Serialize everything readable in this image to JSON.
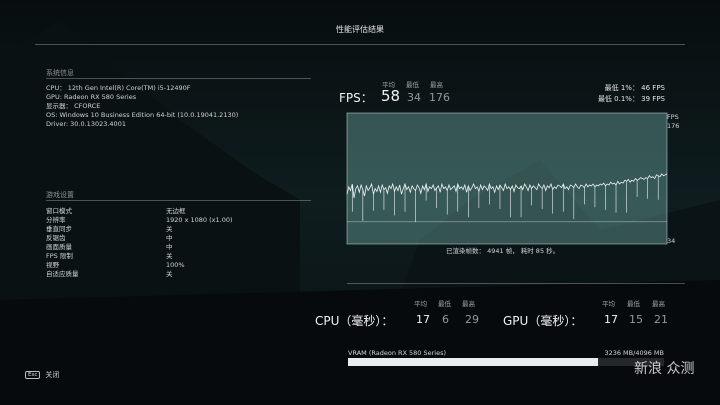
{
  "window": {
    "title": "性能评估结果"
  },
  "system": {
    "heading": "系统信息",
    "cpu": "CPU：  12th Gen Intel(R) Core(TM) i5-12490F",
    "gpu": "GPU: Radeon RX 580 Series",
    "display": "显示器：  CFORCE",
    "os": "OS: Windows 10 Business Edition 64-bit (10.0.19041.2130)",
    "driver": "Driver: 30.0.13023.4001"
  },
  "game": {
    "heading": "游戏设置",
    "settings": [
      {
        "k": "窗口模式",
        "v": "无边框"
      },
      {
        "k": "分辨率",
        "v": "1920 x 1080 (x1.00)"
      },
      {
        "k": "垂直同步",
        "v": "关"
      },
      {
        "k": "反锯齿",
        "v": "中"
      },
      {
        "k": "画面质量",
        "v": "中"
      },
      {
        "k": "FPS 限制",
        "v": "关"
      },
      {
        "k": "视野",
        "v": "100%"
      },
      {
        "k": "自适应质量",
        "v": "关"
      }
    ]
  },
  "fps": {
    "label": "FPS：",
    "avg_hdr": "平均",
    "min_hdr": "最低",
    "max_hdr": "最高",
    "avg": "58",
    "min": "34",
    "max": "176",
    "low1": "最低 1%：  46 FPS",
    "low01": "最低 0.1%：  39 FPS",
    "axis_unit": "FPS",
    "axis_top": "176",
    "axis_bottom": "34",
    "rendered": "已渲染帧数：  4941 帧，  耗时 85 秒。"
  },
  "cpu": {
    "label": "CPU（毫秒）：",
    "avg_hdr": "平均",
    "min_hdr": "最低",
    "max_hdr": "最高",
    "avg": "17",
    "min": "6",
    "max": "29"
  },
  "gpu": {
    "label": "GPU（毫秒）：",
    "avg_hdr": "平均",
    "min_hdr": "最低",
    "max_hdr": "最高",
    "avg": "17",
    "min": "15",
    "max": "21"
  },
  "vram": {
    "label": "VRAM (Radeon RX 580 Series)",
    "value": "3236 MB/4096 MB",
    "used_fraction": 0.79
  },
  "footer": {
    "esc_key": "Esc",
    "close_label": "关闭"
  },
  "watermark": {
    "text": "新浪 众测"
  },
  "chart_data": {
    "type": "line",
    "ylim": [
      34,
      176
    ],
    "series": [
      {
        "values": [
          88,
          96,
          92,
          99,
          84,
          94,
          97,
          90,
          98,
          93,
          86,
          97,
          92,
          95,
          99,
          88,
          94,
          91,
          97,
          90,
          98,
          93,
          95,
          89,
          97,
          94,
          99,
          91,
          96,
          92,
          98,
          88,
          94,
          99,
          93,
          96,
          90,
          97,
          94,
          92,
          98,
          95,
          89,
          97,
          93,
          99,
          91,
          96,
          94,
          98,
          92,
          95,
          97,
          90,
          99,
          94,
          96,
          92,
          98,
          93,
          95,
          97,
          91,
          99,
          94,
          96,
          93,
          98,
          90,
          97,
          92,
          95,
          99,
          94,
          96,
          91,
          98,
          93,
          97,
          95,
          92,
          99,
          94,
          96,
          90,
          97,
          93,
          98,
          95,
          92,
          99,
          94,
          96,
          93,
          97,
          91,
          98,
          95,
          94,
          97,
          93,
          99,
          96,
          92,
          98,
          94,
          97,
          95,
          93,
          99,
          96,
          94,
          98,
          92,
          97,
          95,
          99,
          93,
          96,
          94,
          98,
          97,
          95,
          99,
          94,
          96,
          93,
          98,
          97,
          95,
          99,
          96,
          94,
          98,
          97,
          95,
          99,
          96,
          98,
          97,
          99,
          96,
          98,
          97,
          99,
          98,
          100,
          97,
          99,
          98,
          101,
          99,
          100,
          98,
          102,
          99,
          101,
          100,
          103,
          102,
          104,
          101,
          103,
          102,
          105,
          103,
          104,
          106,
          105,
          104,
          106,
          105,
          108,
          106,
          107,
          105,
          109,
          108,
          107,
          110,
          108,
          109,
          110
        ]
      }
    ]
  }
}
